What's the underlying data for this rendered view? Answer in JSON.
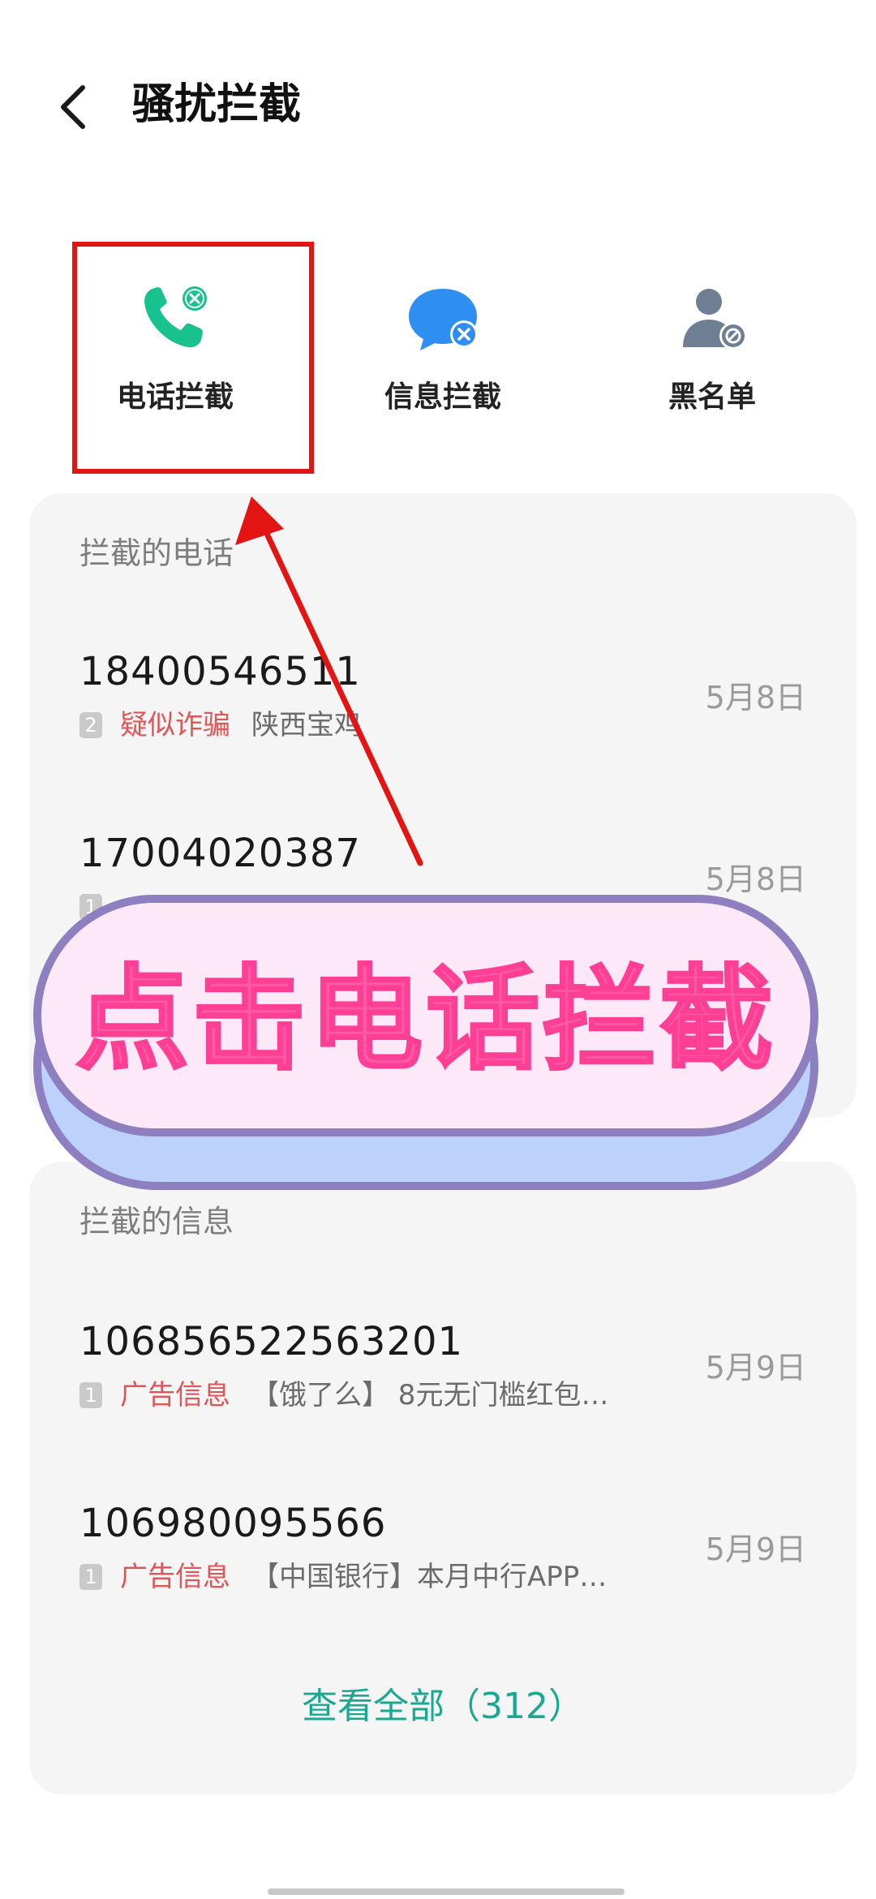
{
  "header": {
    "title": "骚扰拦截"
  },
  "tabs": [
    {
      "label": "电话拦截",
      "icon": "phone-block-icon"
    },
    {
      "label": "信息拦截",
      "icon": "message-block-icon"
    },
    {
      "label": "黑名单",
      "icon": "blacklist-user-icon"
    }
  ],
  "calls": {
    "title": "拦截的电话",
    "items": [
      {
        "number": "18400546511",
        "count": "2",
        "tag": "疑似诈骗",
        "location": "陕西宝鸡",
        "date": "5月8日"
      },
      {
        "number": "17004020387",
        "count": "1",
        "date": "5月8日"
      }
    ]
  },
  "messages": {
    "title": "拦截的信息",
    "items": [
      {
        "number": "106856522563201",
        "count": "1",
        "tag": "广告信息",
        "preview": "【饿了么】 8元无门槛红包已...",
        "date": "5月9日"
      },
      {
        "number": "106980095566",
        "count": "1",
        "tag": "广告信息",
        "preview": "【中国银行】本月中行APP转...",
        "date": "5月9日"
      }
    ],
    "view_all": "查看全部（312）"
  },
  "banner": {
    "text": "点击电话拦截"
  },
  "colors": {
    "accent": "#1aa890",
    "warning_tag": "#e05555",
    "highlight": "#e31414",
    "banner_text": "#ff5aa8",
    "banner_border": "#8e7fc0"
  }
}
